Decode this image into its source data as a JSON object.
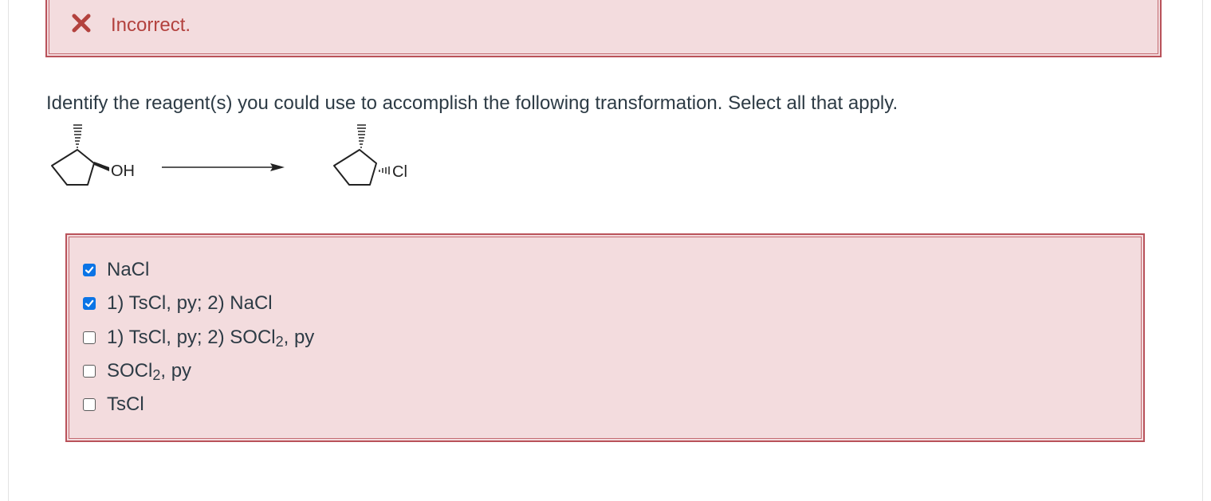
{
  "feedback": {
    "status_icon": "close-icon",
    "message": "Incorrect.",
    "color": "#b3423e",
    "background": "#f3dcde"
  },
  "question": {
    "prompt": "Identify the reagent(s) you could use to accomplish the following transformation. Select all that apply."
  },
  "scheme": {
    "reactant_group": "OH",
    "product_group": "Cl"
  },
  "options": [
    {
      "label": "NaCl",
      "checked": true
    },
    {
      "label": "1) TsCl, py; 2) NaCl",
      "checked": true
    },
    {
      "label_prefix": "1) TsCl, py; 2) SOCl",
      "label_sub": "2",
      "label_suffix": ", py",
      "checked": false
    },
    {
      "label_prefix": "SOCl",
      "label_sub": "2",
      "label_suffix": ", py",
      "checked": false
    },
    {
      "label": "TsCl",
      "checked": false
    }
  ],
  "colors": {
    "checkbox_checked": "#0b74e6",
    "incorrect_border": "#b9525a"
  }
}
